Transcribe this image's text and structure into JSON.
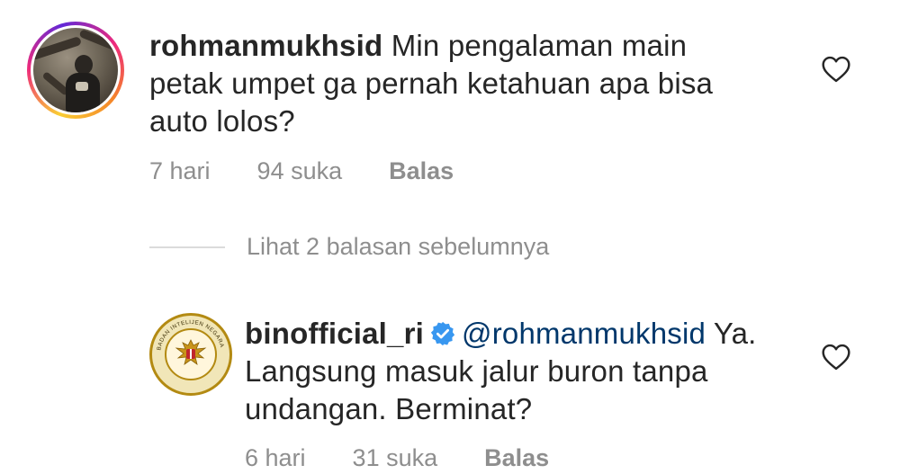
{
  "comments": [
    {
      "username": "rohmanmukhsid",
      "text_lines": [
        "Min pengalaman main",
        "petak umpet ga pernah ketahuan apa bisa",
        "auto lolos?"
      ],
      "time": "7 hari",
      "likes": "94 suka",
      "reply_label": "Balas"
    },
    {
      "username": "binofficial_ri",
      "verified": true,
      "mention": "@rohmanmukhsid",
      "text_first_rest": " Ya.",
      "text_lines": [
        "Langsung masuk jalur buron tanpa",
        "undangan. Berminat?"
      ],
      "time": "6 hari",
      "likes": "31 suka",
      "reply_label": "Balas"
    }
  ],
  "view_previous_replies": "Lihat 2 balasan sebelumnya",
  "bin_logo_text": "BADAN INTELIJEN NEGARA · REPUBLIK INDONESIA",
  "colors": {
    "text": "#262626",
    "secondary": "#8e8e8e",
    "mention": "#00376b",
    "verified": "#3897f0"
  },
  "icons": [
    "heart-icon",
    "verified-badge-icon"
  ]
}
